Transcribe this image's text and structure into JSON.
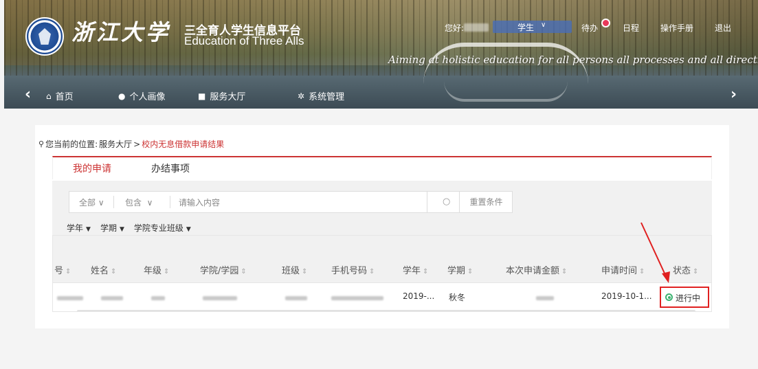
{
  "header": {
    "logo_text": "浙江大学",
    "platform_title_cn": "三全育人学生信息平台",
    "platform_title_en": "Education of Three Alls",
    "slogan": "Aiming at holistic education for all persons all processes and all directions",
    "greeting": "您好:",
    "role": "学生",
    "todo": "待办",
    "schedule": "日程",
    "manual": "操作手册",
    "logout": "退出"
  },
  "nav": {
    "items": [
      {
        "label": "首页",
        "icon": "home-icon"
      },
      {
        "label": "个人画像",
        "icon": "user-icon"
      },
      {
        "label": "服务大厅",
        "icon": "briefcase-icon"
      },
      {
        "label": "系统管理",
        "icon": "gears-icon"
      }
    ]
  },
  "breadcrumb": {
    "prefix": "您当前的位置:",
    "parent": "服务大厅",
    "separator": ">",
    "current": "校内无息借款申请结果"
  },
  "tabs": [
    {
      "label": "我的申请",
      "active": true
    },
    {
      "label": "办结事项",
      "active": false
    }
  ],
  "filter": {
    "scope": "全部",
    "match": "包含",
    "placeholder": "请输入内容",
    "reset": "重置条件",
    "dropdowns": [
      "学年",
      "学期",
      "学院专业班级"
    ]
  },
  "table": {
    "columns": [
      "号",
      "姓名",
      "年级",
      "学院/学园",
      "班级",
      "手机号码",
      "学年",
      "学期",
      "本次申请金额",
      "申请时间",
      "状态"
    ],
    "rows": [
      {
        "year": "2019-...",
        "term": "秋冬",
        "time": "2019-10-1...",
        "status": "进行中"
      }
    ]
  },
  "colors": {
    "accent": "#cc3333",
    "status_active": "#3cb371",
    "annotation": "#e02020"
  }
}
